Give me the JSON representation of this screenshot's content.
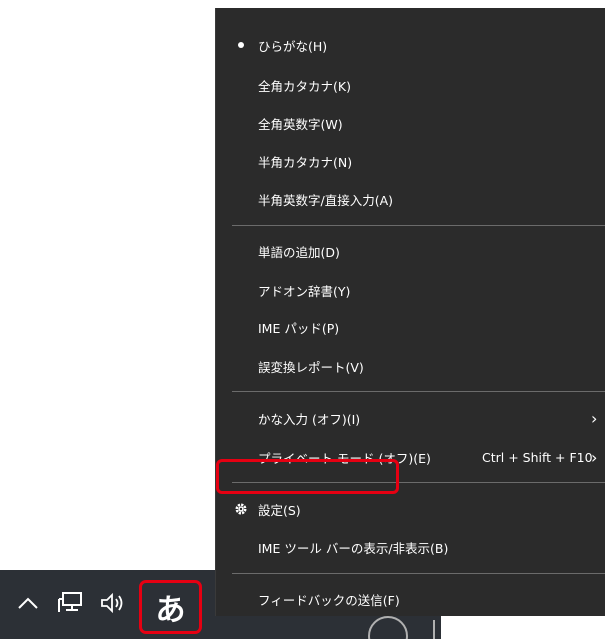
{
  "menu": {
    "items": [
      {
        "label": "ひらがな(H)",
        "selected": true
      },
      {
        "label": "全角カタカナ(K)"
      },
      {
        "label": "全角英数字(W)"
      },
      {
        "label": "半角カタカナ(N)"
      },
      {
        "label": "半角英数字/直接入力(A)"
      },
      {
        "label": "単語の追加(D)"
      },
      {
        "label": "アドオン辞書(Y)"
      },
      {
        "label": "IME パッド(P)"
      },
      {
        "label": "誤変換レポート(V)"
      },
      {
        "label": "かな入力 (オフ)(I)",
        "submenu_arrow": "›"
      },
      {
        "label": "プライベート モード (オフ)(E)",
        "shortcut": "Ctrl + Shift + F10",
        "submenu_arrow": "›"
      },
      {
        "label": "設定(S)",
        "icon": "gear-icon",
        "highlighted": true
      },
      {
        "label": "IME ツール バーの表示/非表示(B)"
      },
      {
        "label": "フィードバックの送信(F)"
      }
    ]
  },
  "taskbar": {
    "ime_indicator": "あ",
    "icons": [
      "chevron-up-icon",
      "network-icon",
      "volume-icon"
    ]
  },
  "colors": {
    "menu_bg": "#2b2b2b",
    "taskbar_bg": "#2c3036",
    "highlight": "#e60012",
    "text": "#ffffff"
  }
}
